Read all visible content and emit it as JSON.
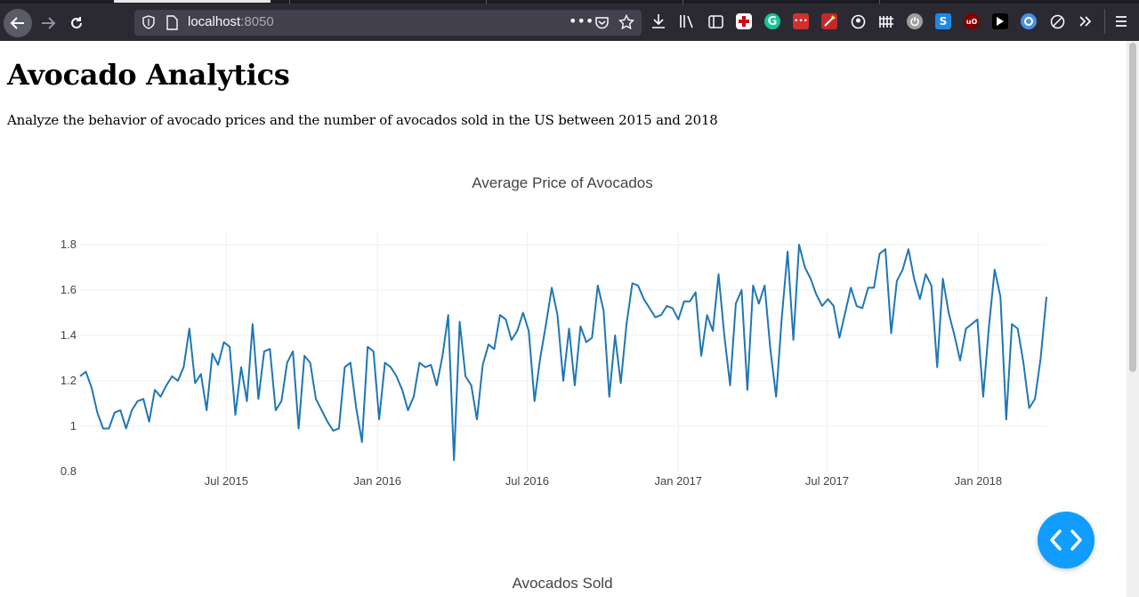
{
  "browser": {
    "url_host": "localhost",
    "url_port": ":8050"
  },
  "page": {
    "title": "Avocado Analytics",
    "description": "Analyze the behavior of avocado prices and the number of avocados sold in the US between 2015 and 2018"
  },
  "chart_data": [
    {
      "type": "line",
      "title": "Average Price of Avocados",
      "xlabel": "",
      "ylabel": "",
      "x_range": [
        "2015-01-04",
        "2018-03-25"
      ],
      "ylim": [
        0.8,
        1.85
      ],
      "yticks": [
        0.8,
        1,
        1.2,
        1.4,
        1.6,
        1.8
      ],
      "ytick_labels": [
        "0.8",
        "1",
        "1.2",
        "1.4",
        "1.6",
        "1.8"
      ],
      "xticks": [
        "2015-07-01",
        "2016-01-01",
        "2016-07-01",
        "2017-01-01",
        "2017-07-01",
        "2018-01-01"
      ],
      "xtick_labels": [
        "Jul 2015",
        "Jan 2016",
        "Jul 2016",
        "Jan 2017",
        "Jul 2017",
        "Jan 2018"
      ],
      "grid": true,
      "line_color": "#1f77b4",
      "series": [
        {
          "start_date": "2015-01-04",
          "frequency": "weekly",
          "values": [
            1.22,
            1.24,
            1.17,
            1.06,
            0.99,
            0.99,
            1.06,
            1.07,
            0.99,
            1.07,
            1.11,
            1.12,
            1.02,
            1.16,
            1.13,
            1.18,
            1.22,
            1.2,
            1.26,
            1.43,
            1.19,
            1.23,
            1.07,
            1.32,
            1.27,
            1.37,
            1.35,
            1.05,
            1.26,
            1.11,
            1.45,
            1.12,
            1.33,
            1.34,
            1.07,
            1.11,
            1.28,
            1.33,
            0.99,
            1.31,
            1.28,
            1.12,
            1.07,
            1.02,
            0.98,
            0.99,
            1.26,
            1.28,
            1.08,
            0.93,
            1.35,
            1.33,
            1.03,
            1.28,
            1.26,
            1.22,
            1.16,
            1.07,
            1.13,
            1.28,
            1.26,
            1.27,
            1.18,
            1.31,
            1.49,
            0.85,
            1.46,
            1.22,
            1.18,
            1.03,
            1.27,
            1.36,
            1.34,
            1.49,
            1.47,
            1.38,
            1.42,
            1.5,
            1.42,
            1.11,
            1.3,
            1.45,
            1.61,
            1.49,
            1.2,
            1.43,
            1.18,
            1.44,
            1.37,
            1.39,
            1.62,
            1.51,
            1.13,
            1.4,
            1.19,
            1.45,
            1.63,
            1.62,
            1.56,
            1.52,
            1.48,
            1.49,
            1.53,
            1.52,
            1.47,
            1.55,
            1.55,
            1.59,
            1.31,
            1.49,
            1.42,
            1.67,
            1.4,
            1.18,
            1.54,
            1.6,
            1.16,
            1.62,
            1.54,
            1.62,
            1.34,
            1.13,
            1.48,
            1.77,
            1.38,
            1.8,
            1.7,
            1.65,
            1.58,
            1.53,
            1.56,
            1.53,
            1.39,
            1.5,
            1.61,
            1.53,
            1.52,
            1.61,
            1.61,
            1.76,
            1.78,
            1.41,
            1.64,
            1.69,
            1.78,
            1.65,
            1.56,
            1.67,
            1.62,
            1.26,
            1.65,
            1.5,
            1.4,
            1.29,
            1.43,
            1.45,
            1.47,
            1.13,
            1.44,
            1.69,
            1.57,
            1.03,
            1.45,
            1.43,
            1.28,
            1.08,
            1.12,
            1.3,
            1.57
          ]
        }
      ]
    },
    {
      "type": "line",
      "title": "Avocados Sold"
    }
  ]
}
